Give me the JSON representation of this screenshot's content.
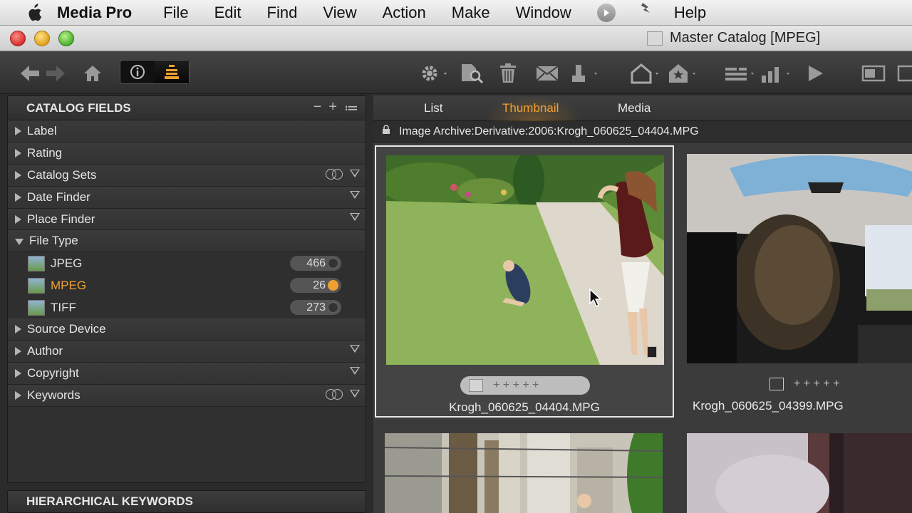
{
  "menubar": {
    "app": "Media Pro",
    "items": [
      "File",
      "Edit",
      "Find",
      "View",
      "Action",
      "Make",
      "Window",
      "Help"
    ]
  },
  "window": {
    "title": "Master Catalog [MPEG]"
  },
  "panel": {
    "title": "CATALOG FIELDS",
    "tools": [
      "−",
      "+",
      "≔"
    ],
    "fields": [
      {
        "label": "Label"
      },
      {
        "label": "Rating"
      },
      {
        "label": "Catalog Sets"
      },
      {
        "label": "Date Finder"
      },
      {
        "label": "Place Finder"
      },
      {
        "label": "File Type"
      }
    ],
    "file_types": [
      {
        "label": "JPEG",
        "count": "466"
      },
      {
        "label": "MPEG",
        "count": "26"
      },
      {
        "label": "TIFF",
        "count": "273"
      }
    ],
    "fields_after": [
      {
        "label": "Source Device"
      },
      {
        "label": "Author"
      },
      {
        "label": "Copyright"
      },
      {
        "label": "Keywords"
      }
    ],
    "bottom_title": "HIERARCHICAL KEYWORDS"
  },
  "tabs": [
    "List",
    "Thumbnail",
    "Media"
  ],
  "path": "Image Archive:Derivative:2006:Krogh_060625_04404.MPG",
  "thumbnails": [
    {
      "name": "Krogh_060625_04404.MPG",
      "rating": "+ + + + +"
    },
    {
      "name": "Krogh_060625_04399.MPG",
      "rating": "+ + + + +"
    }
  ],
  "colors": {
    "accent": "#f0a030",
    "panel_bg": "#303030",
    "toolbar": "#3a3a3a"
  }
}
